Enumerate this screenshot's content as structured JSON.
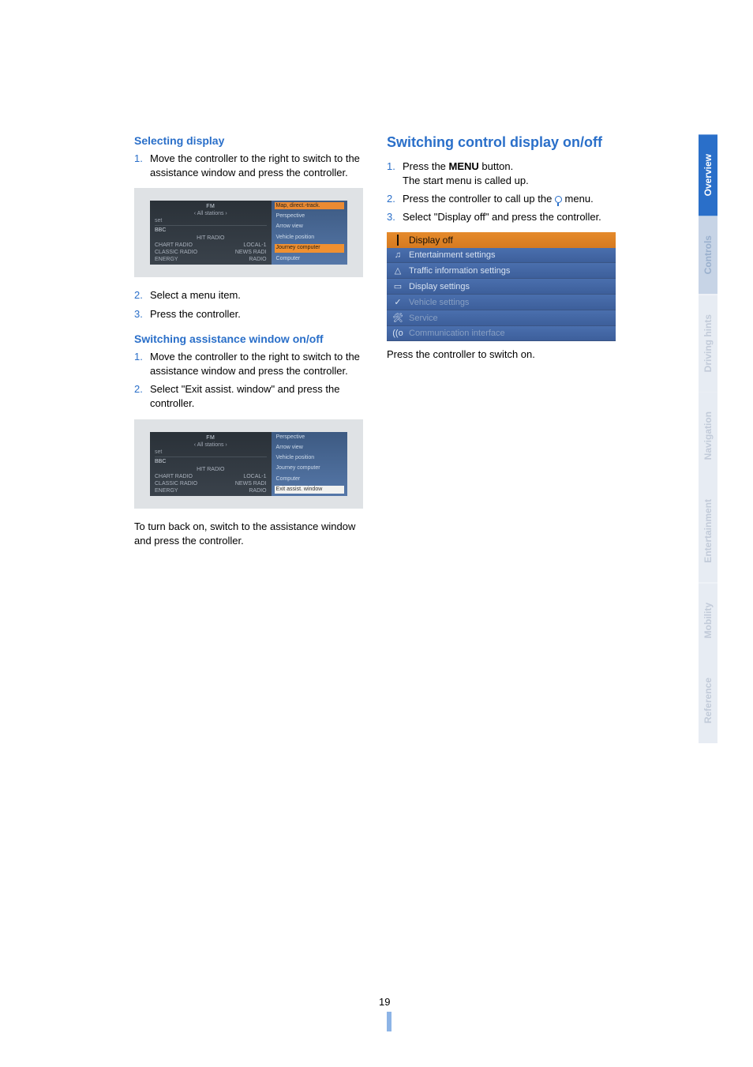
{
  "left": {
    "h1": "Selecting display",
    "l1": {
      "n": "1.",
      "t": "Move the controller to the right to switch to the assistance window and press the controller."
    },
    "ss1": {
      "top": "FM",
      "sub": "‹ All stations ›",
      "set": "set",
      "bbc": "BBC",
      "hit": "HIT RADIO",
      "chart": "CHART RADIO",
      "local": "LOCAL-1",
      "classic": "CLASSIC RADIO",
      "news": "NEWS RADI",
      "energy": "ENERGY",
      "radio": "RADIO",
      "r1": "Map, direct.-track.",
      "r2": "Perspective",
      "r3": "Arrow view",
      "r4": "Vehicle position",
      "r5": "Journey computer",
      "r6": "Computer"
    },
    "l2": {
      "n": "2.",
      "t": "Select a menu item."
    },
    "l3": {
      "n": "3.",
      "t": "Press the controller."
    },
    "h2": "Switching assistance window on/off",
    "l4": {
      "n": "1.",
      "t": "Move the controller to the right to switch to the assistance window and press the controller."
    },
    "l5": {
      "n": "2.",
      "t": "Select \"Exit assist. window\" and press the controller."
    },
    "ss2": {
      "r1": "Perspective",
      "r2": "Arrow view",
      "r3": "Vehicle position",
      "r4": "Journey computer",
      "r5": "Computer",
      "r6": "Exit assist. window"
    },
    "p_last": "To turn back on, switch to the assistance window and press the controller."
  },
  "right": {
    "h1": "Switching control display on/off",
    "l1a": {
      "n": "1.",
      "t": "Press the "
    },
    "l1b": "MENU",
    "l1c": " button.",
    "l1d": "The start menu is called up.",
    "l2a": {
      "n": "2.",
      "t": "Press the controller to call up the "
    },
    "l2b": " menu.",
    "l3": {
      "n": "3.",
      "t": "Select \"Display off\" and press the controller."
    },
    "menu": {
      "m0": "Display off",
      "m1": "Entertainment settings",
      "m2": "Traffic information settings",
      "m3": "Display settings",
      "m4": "Vehicle settings",
      "m5": "Service",
      "m6": "Communication interface"
    },
    "p_last": "Press the controller to switch on."
  },
  "tabs": {
    "overview": "Overview",
    "controls": "Controls",
    "driving": "Driving hints",
    "nav": "Navigation",
    "ent": "Entertainment",
    "mob": "Mobility",
    "ref": "Reference"
  },
  "page": "19"
}
